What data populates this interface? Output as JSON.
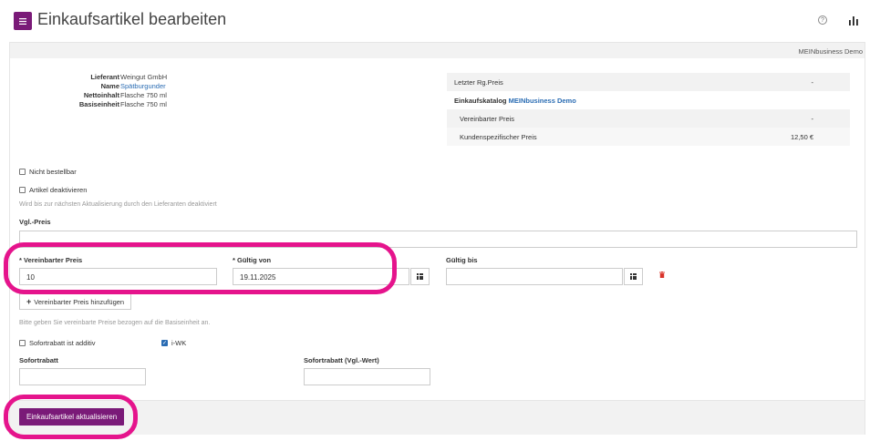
{
  "header": {
    "menu_icon": "menu-icon",
    "title": "Einkaufsartikel bearbeiten",
    "help_icon": "?",
    "stats_icon": "bar-chart-icon"
  },
  "panel": {
    "company": "MEINbusiness Demo"
  },
  "article_info": {
    "labels": [
      "Lieferant",
      "Name",
      "Nettoinhalt",
      "Basiseinheit"
    ],
    "supplier": "Weingut GmbH",
    "name": "Spätburgunder",
    "net_content": "Flasche 750 ml",
    "base_unit": "Flasche 750 ml"
  },
  "price_table": {
    "last_invoice_label": "Letzter Rg.Preis",
    "last_invoice_value": "-",
    "catalog_label": "Einkaufskatalog",
    "catalog_name": "MEINbusiness Demo",
    "agreed_label": "Vereinbarter Preis",
    "agreed_value": "-",
    "customer_label": "Kundenspezifischer Preis",
    "customer_value": "12,50 €"
  },
  "flags": {
    "not_orderable": "Nicht bestellbar",
    "deactivate": "Artikel deaktivieren",
    "deactivate_hint": "Wird bis zur nächsten Aktualisierung durch den Lieferanten deaktiviert"
  },
  "comparison_price": {
    "label": "Vgl.-Preis",
    "value": ""
  },
  "agreed_price": {
    "price_label": "* Vereinbarter Preis",
    "price_value": "10",
    "valid_from_label": "* Gültig von",
    "valid_from_value": "19.11.2025",
    "valid_to_label": "Gültig bis",
    "valid_to_value": "",
    "add_button": "Vereinbarter Preis hinzufügen",
    "hint": "Bitte geben Sie vereinbarte Preise bezogen auf die Basiseinheit an."
  },
  "discount": {
    "additive_label": "Sofortrabatt ist additiv",
    "iwk_label": "i-WK",
    "iwk_checked": true,
    "discount_label": "Sofortrabatt",
    "discount_value": "",
    "discount_vgl_label": "Sofortrabatt (Vgl.-Wert)",
    "discount_vgl_value": ""
  },
  "footer": {
    "submit": "Einkaufsartikel aktualisieren"
  },
  "colors": {
    "brand": "#7a1a78",
    "highlight": "#e5148c",
    "link": "#2a6cb3"
  }
}
